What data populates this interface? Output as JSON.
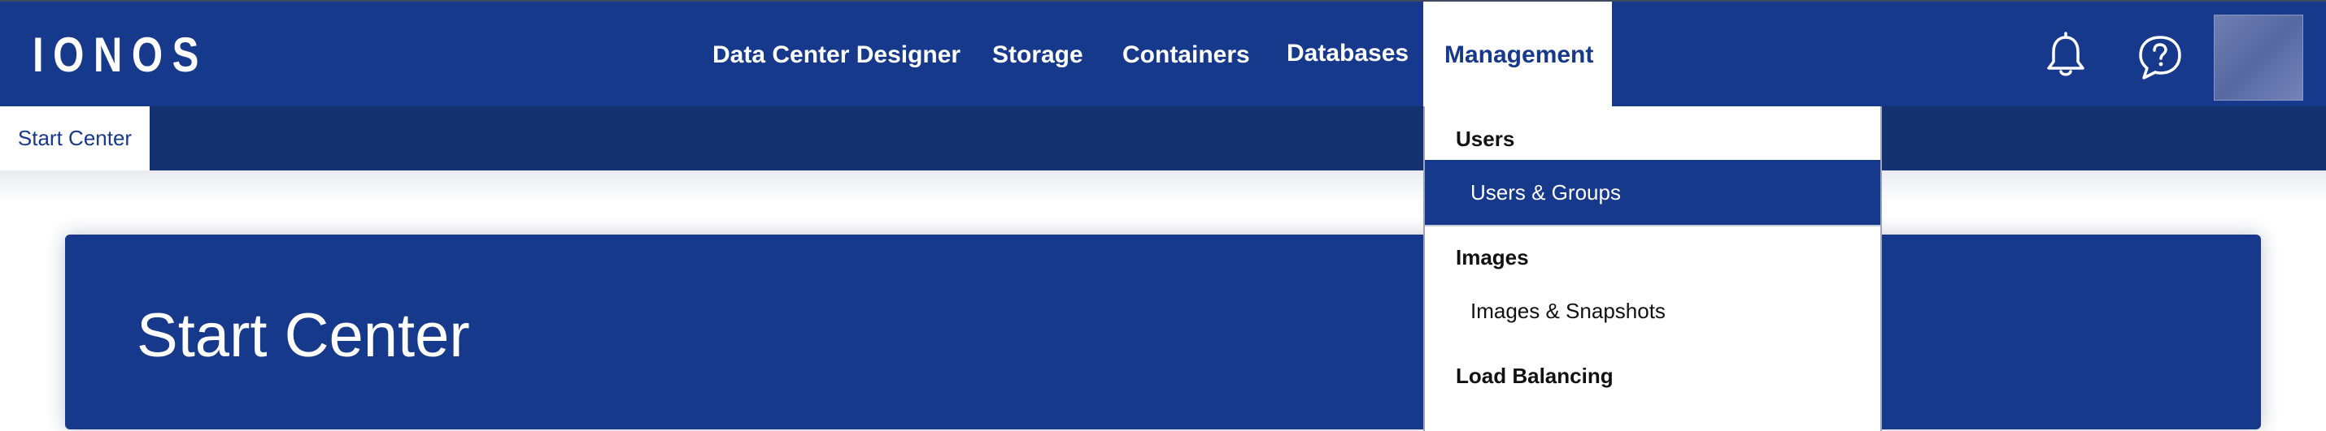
{
  "header": {
    "logo": "IONOS",
    "nav": [
      {
        "label": "Data Center Designer"
      },
      {
        "label": "Storage"
      },
      {
        "label": "Containers"
      },
      {
        "label": "Databases"
      },
      {
        "label": "Management",
        "active": true
      }
    ],
    "icons": [
      "bell-icon",
      "help-chat-icon"
    ],
    "avatar": "user-avatar"
  },
  "subnav": {
    "tab": "Start Center"
  },
  "main": {
    "title": "Start Center"
  },
  "management_menu": {
    "sections": [
      {
        "heading": "Users",
        "items": [
          {
            "label": "Users & Groups",
            "selected": true
          }
        ]
      },
      {
        "heading": "Images",
        "items": [
          {
            "label": "Images & Snapshots",
            "selected": false
          }
        ]
      },
      {
        "heading": "Load Balancing",
        "items": []
      }
    ]
  },
  "colors": {
    "brand": "#17398c",
    "subbar": "#14326f",
    "text_dark": "#111111"
  }
}
